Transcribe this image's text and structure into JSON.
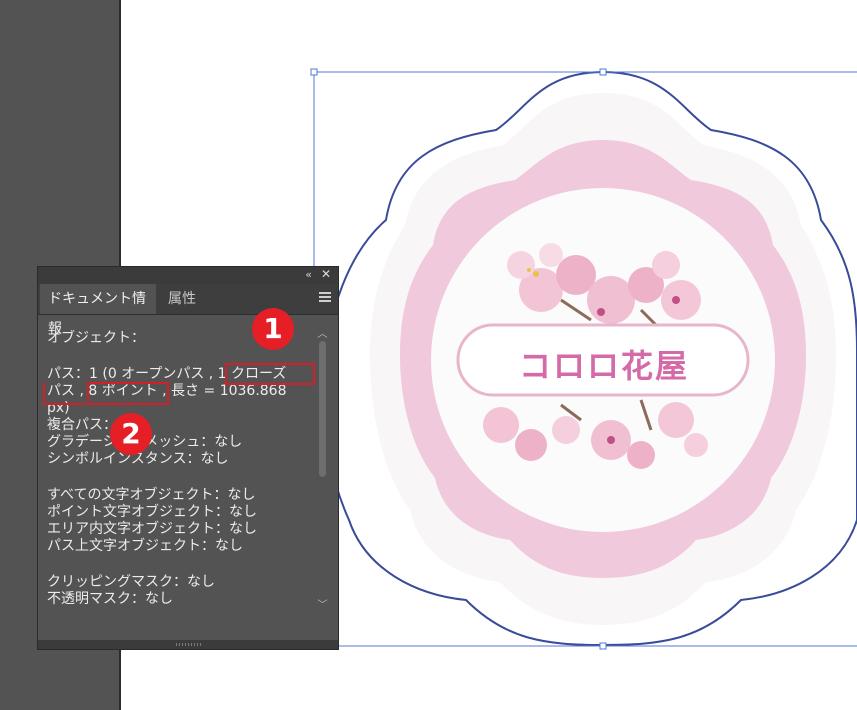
{
  "panel": {
    "collapse_icon": "«",
    "close_icon": "✕",
    "tabs": [
      {
        "label": "ドキュメント情報",
        "active": true
      },
      {
        "label": "属性",
        "active": false
      }
    ],
    "content": {
      "object_label": "オブジェクト：",
      "path_line1": "パス：1 (0 オープンパス , 1 クローズ",
      "path_line2": "パス , 8 ポイント , 長さ = 1036.868",
      "path_line3": "px)",
      "compound_path": "複合パス：なし",
      "gradient_mesh": "グラデーションメッシュ：なし",
      "symbol_instances": "シンボルインスタンス：なし",
      "all_text": "すべての文字オブジェクト：なし",
      "point_text": "ポイント文字オブジェクト：なし",
      "area_text": "エリア内文字オブジェクト：なし",
      "path_text": "パス上文字オブジェクト：なし",
      "clipping_mask": "クリッピングマスク：なし",
      "opacity_mask": "不透明マスク：なし"
    }
  },
  "annotations": [
    {
      "number": "1",
      "note": "1 クローズパス"
    },
    {
      "number": "2",
      "note": "8 ポイント"
    }
  ],
  "artwork": {
    "logo_text": "コロロ花屋",
    "colors": {
      "outline": "#3a4b9a",
      "pink_band": "#f1c9dc",
      "text": "#d56aa8",
      "selection": "#5277d6"
    }
  },
  "colors": {
    "panel_bg": "#535353",
    "accent_red": "#e61e26"
  }
}
